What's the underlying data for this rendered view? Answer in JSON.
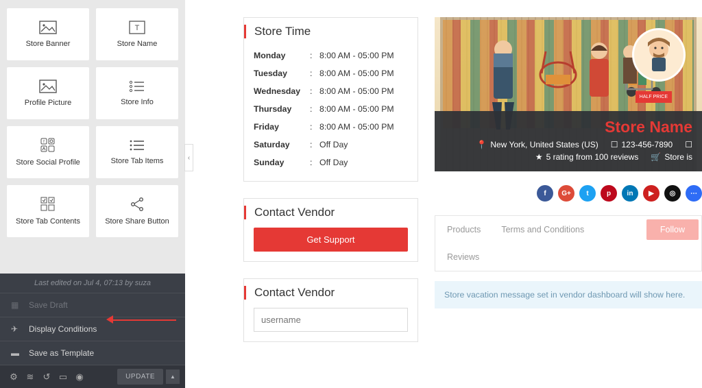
{
  "sidebar": {
    "widgets": [
      {
        "label": "Store Banner"
      },
      {
        "label": "Store Name"
      },
      {
        "label": "Profile Picture"
      },
      {
        "label": "Store Info"
      },
      {
        "label": "Store Social Profile"
      },
      {
        "label": "Store Tab Items"
      },
      {
        "label": "Store Tab Contents"
      },
      {
        "label": "Store Share Button"
      }
    ],
    "last_edited": "Last edited on Jul 4, 07:13 by suza",
    "footer_items": {
      "save_draft": "Save Draft",
      "display_conditions": "Display Conditions",
      "save_template": "Save as Template"
    },
    "update_label": "UPDATE"
  },
  "store_time": {
    "title": "Store Time",
    "rows": [
      {
        "day": "Monday",
        "hours": "8:00 AM - 05:00 PM"
      },
      {
        "day": "Tuesday",
        "hours": "8:00 AM - 05:00 PM"
      },
      {
        "day": "Wednesday",
        "hours": "8:00 AM - 05:00 PM"
      },
      {
        "day": "Thursday",
        "hours": "8:00 AM - 05:00 PM"
      },
      {
        "day": "Friday",
        "hours": "8:00 AM - 05:00 PM"
      },
      {
        "day": "Saturday",
        "hours": "Off Day"
      },
      {
        "day": "Sunday",
        "hours": "Off Day"
      }
    ]
  },
  "contact_vendor": {
    "title": "Contact Vendor",
    "button": "Get Support"
  },
  "contact_form": {
    "title": "Contact Vendor",
    "placeholder_username": "username"
  },
  "banner": {
    "store_name": "Store Name",
    "location": "New York, United States (US)",
    "phone": "123-456-7890",
    "rating": "5 rating from 100 reviews",
    "shop_status": "Store is",
    "badge": "HALF PRICE"
  },
  "tabs": {
    "items": [
      "Products",
      "Terms and Conditions",
      "Reviews"
    ],
    "follow": "Follow"
  },
  "vacation_msg": "Store vacation message set in vendor dashboard will show here."
}
